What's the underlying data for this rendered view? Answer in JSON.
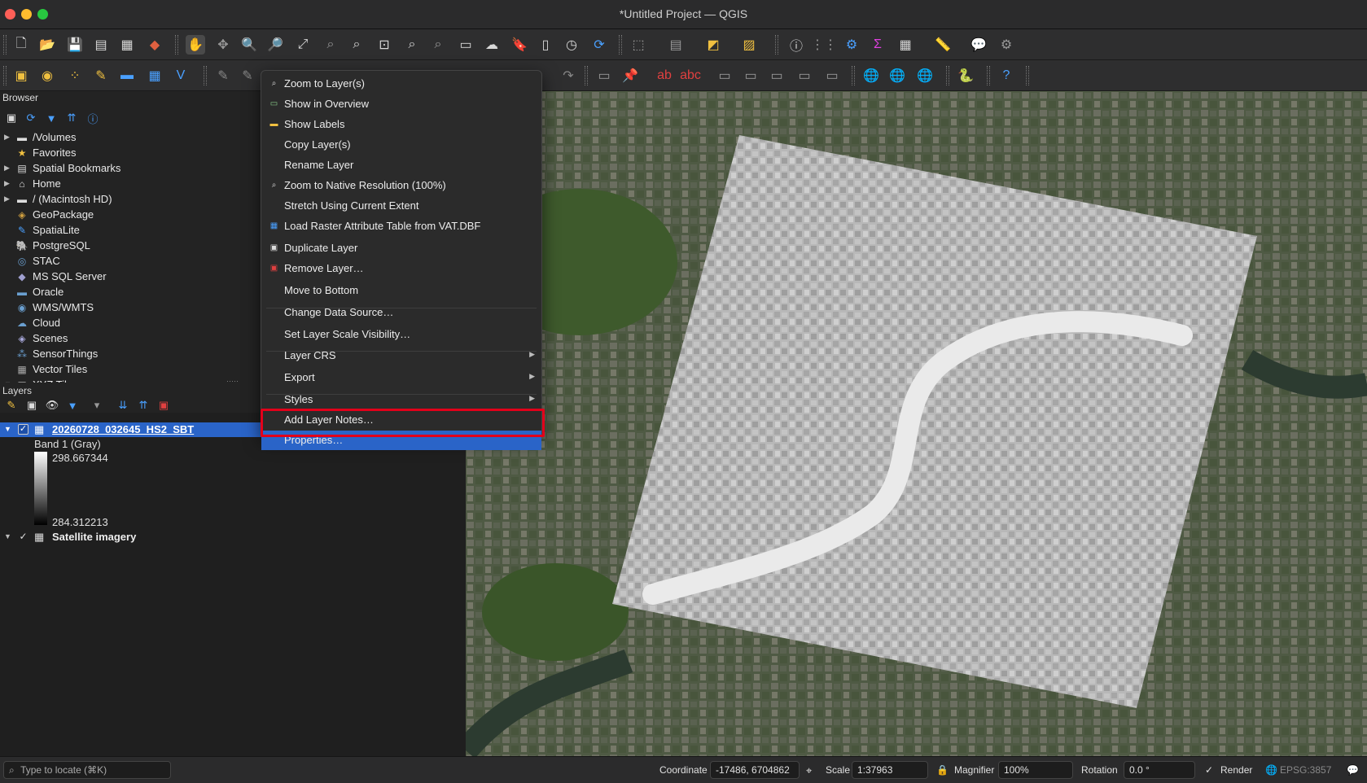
{
  "window": {
    "title": "*Untitled Project — QGIS"
  },
  "browser": {
    "title": "Browser",
    "items": [
      {
        "label": "/Volumes",
        "icon": "folder-icon",
        "expandable": true
      },
      {
        "label": "Favorites",
        "icon": "star-icon",
        "expandable": false
      },
      {
        "label": "Spatial Bookmarks",
        "icon": "bookmarks-icon",
        "expandable": true
      },
      {
        "label": "Home",
        "icon": "home-folder-icon",
        "expandable": true
      },
      {
        "label": "/ (Macintosh HD)",
        "icon": "folder-icon",
        "expandable": true
      },
      {
        "label": "GeoPackage",
        "icon": "geopackage-icon",
        "expandable": false
      },
      {
        "label": "SpatiaLite",
        "icon": "spatialite-icon",
        "expandable": false
      },
      {
        "label": "PostgreSQL",
        "icon": "postgresql-icon",
        "expandable": false
      },
      {
        "label": "STAC",
        "icon": "stac-icon",
        "expandable": false
      },
      {
        "label": "MS SQL Server",
        "icon": "mssql-icon",
        "expandable": false
      },
      {
        "label": "Oracle",
        "icon": "oracle-icon",
        "expandable": false
      },
      {
        "label": "WMS/WMTS",
        "icon": "wms-icon",
        "expandable": false
      },
      {
        "label": "Cloud",
        "icon": "cloud-icon",
        "expandable": false
      },
      {
        "label": "Scenes",
        "icon": "scenes-icon",
        "expandable": false
      },
      {
        "label": "SensorThings",
        "icon": "sensorthings-icon",
        "expandable": false
      },
      {
        "label": "Vector Tiles",
        "icon": "vector-tiles-icon",
        "expandable": false
      },
      {
        "label": "XYZ Tiles",
        "icon": "xyz-tiles-icon",
        "expandable": true
      }
    ]
  },
  "layers": {
    "title": "Layers",
    "items": [
      {
        "name": "20260728_032645_HS2_SBT",
        "checked": true,
        "selected": true
      },
      {
        "name": "Satellite imagery",
        "checked": true,
        "selected": false
      }
    ],
    "legend": {
      "band": "Band 1 (Gray)",
      "max": "298.667344",
      "min": "284.312213"
    }
  },
  "context_menu": {
    "items": [
      {
        "label": "Zoom to Layer(s)",
        "icon": "zoom-layer-icon",
        "submenu": false
      },
      {
        "label": "Show in Overview",
        "icon": "overview-icon",
        "submenu": false
      },
      {
        "label": "Show Labels",
        "icon": "labels-icon",
        "submenu": false
      },
      {
        "label": "Copy Layer(s)",
        "icon": "",
        "submenu": false
      },
      {
        "label": "Rename Layer",
        "icon": "",
        "submenu": false
      },
      {
        "label": "Zoom to Native Resolution (100%)",
        "icon": "native-resolution-icon",
        "submenu": false
      },
      {
        "label": "Stretch Using Current Extent",
        "icon": "",
        "submenu": false
      },
      {
        "label": "Load Raster Attribute Table from VAT.DBF",
        "icon": "attribute-table-icon",
        "submenu": false
      },
      {
        "label": "Duplicate Layer",
        "icon": "duplicate-icon",
        "submenu": false
      },
      {
        "label": "Remove Layer…",
        "icon": "remove-layer-icon",
        "submenu": false
      },
      {
        "label": "Move to Bottom",
        "icon": "",
        "submenu": false
      },
      {
        "label": "Change Data Source…",
        "icon": "",
        "submenu": false
      },
      {
        "label": "Set Layer Scale Visibility…",
        "icon": "",
        "submenu": false
      },
      {
        "label": "Layer CRS",
        "icon": "",
        "submenu": true
      },
      {
        "label": "Export",
        "icon": "",
        "submenu": true
      },
      {
        "label": "Styles",
        "icon": "",
        "submenu": true
      },
      {
        "label": "Add Layer Notes…",
        "icon": "",
        "submenu": false
      },
      {
        "label": "Properties…",
        "icon": "",
        "submenu": false,
        "selected": true
      }
    ]
  },
  "statusbar": {
    "locate_placeholder": "Type to locate (⌘K)",
    "coordinate_label": "Coordinate",
    "coordinate_value": "-17486, 6704862",
    "scale_label": "Scale",
    "scale_value": "1:37963",
    "magnifier_label": "Magnifier",
    "magnifier_value": "100%",
    "rotation_label": "Rotation",
    "rotation_value": "0.0 °",
    "render_label": "Render",
    "crs_value": "EPSG:3857"
  },
  "colors": {
    "selection": "#2a64c8",
    "highlight_box": "#e2001a",
    "layer_link": "#6aa5ff"
  }
}
